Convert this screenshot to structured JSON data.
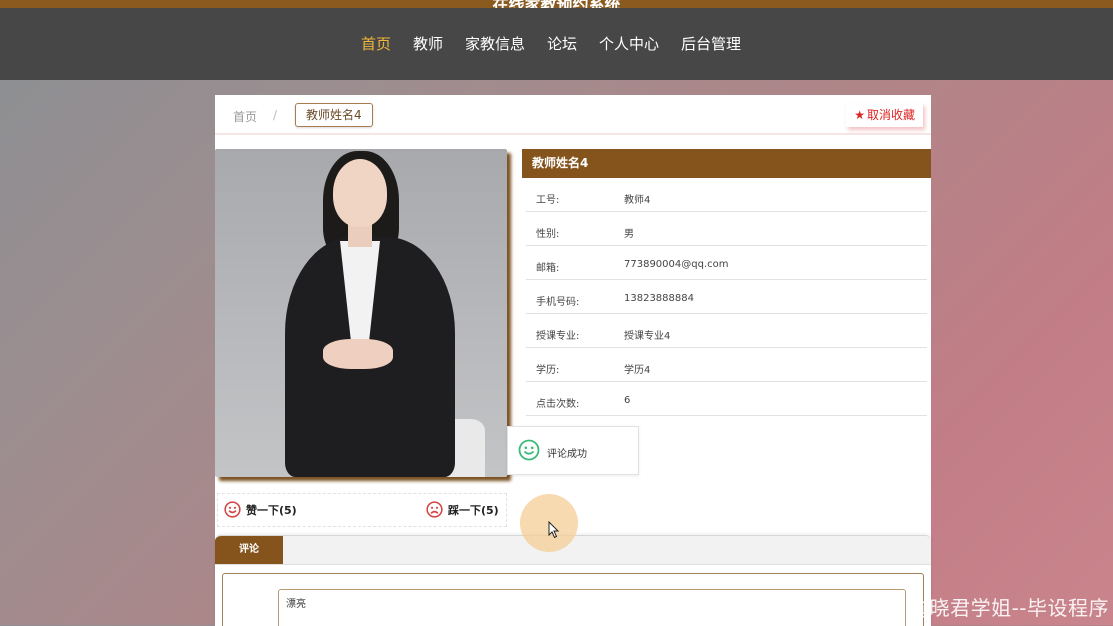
{
  "site": {
    "title": "在线家教预约系统"
  },
  "nav": {
    "items": [
      "首页",
      "教师",
      "家教信息",
      "论坛",
      "个人中心",
      "后台管理"
    ],
    "active": "首页"
  },
  "breadcrumb": {
    "home": "首页",
    "separator": "/",
    "current": "教师姓名4"
  },
  "favorite": {
    "label": "取消收藏"
  },
  "teacher": {
    "name": "教师姓名4",
    "fields": [
      {
        "label": "工号:",
        "value": "教师4"
      },
      {
        "label": "性别:",
        "value": "男"
      },
      {
        "label": "邮箱:",
        "value": "773890004@qq.com"
      },
      {
        "label": "手机号码:",
        "value": "13823888884"
      },
      {
        "label": "授课专业:",
        "value": "授课专业4"
      },
      {
        "label": "学历:",
        "value": "学历4"
      },
      {
        "label": "点击次数:",
        "value": "6"
      }
    ]
  },
  "toast": {
    "message": "评论成功"
  },
  "votes": {
    "like": "赞一下(5)",
    "dislike": "踩一下(5)"
  },
  "comments": {
    "tab": "评论",
    "input_value": "漂亮"
  },
  "watermark": "CSDN @晓君学姐--毕设程序",
  "colors": {
    "brand": "#85541d",
    "nav_bg": "#474747",
    "nav_active": "#f0b63a",
    "fav": "#dd2222",
    "smile_green": "#3cb878",
    "smile_red": "#d44444"
  },
  "icons": {
    "favorite": "star-icon",
    "toast": "smile-icon",
    "like": "smile-icon",
    "dislike": "frown-icon",
    "pointer": "cursor-icon"
  }
}
